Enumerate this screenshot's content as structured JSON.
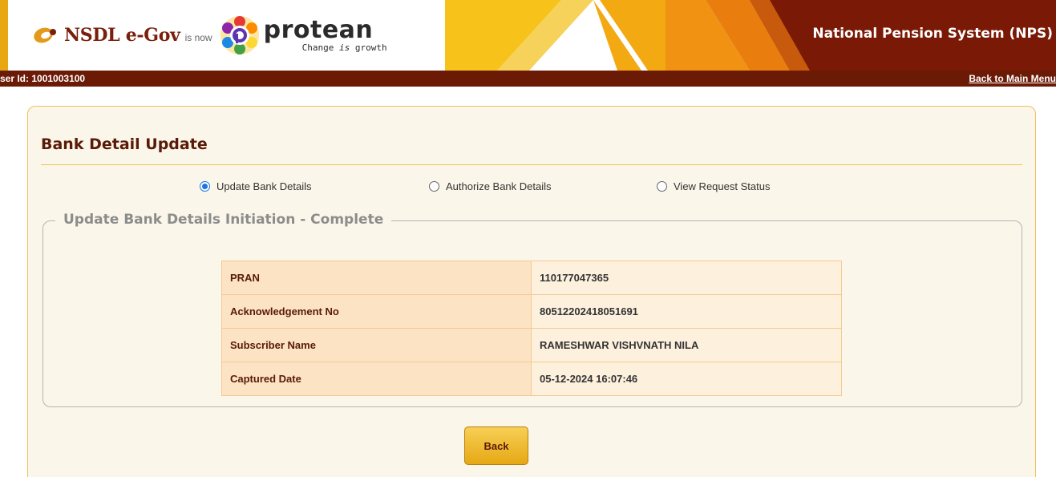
{
  "header": {
    "nsdl_logo": "NSDL e-Gov",
    "is_now": "is now",
    "protean_logo": "protean",
    "protean_tagline_pre": "Change ",
    "protean_tagline_is": "is",
    "protean_tagline_post": " growth",
    "system_title": "National Pension System (NPS)",
    "user_id": "ser Id: 1001003100",
    "back_to_menu": "Back to Main Menu"
  },
  "page": {
    "title": "Bank Detail Update"
  },
  "radio_options": [
    {
      "label": "Update Bank Details",
      "checked": true
    },
    {
      "label": "Authorize Bank Details",
      "checked": false
    },
    {
      "label": "View Request Status",
      "checked": false
    }
  ],
  "section": {
    "legend": "Update Bank Details Initiation - Complete"
  },
  "details": [
    {
      "label": "PRAN",
      "value": "110177047365"
    },
    {
      "label": "Acknowledgement No",
      "value": "80512202418051691"
    },
    {
      "label": "Subscriber Name",
      "value": "RAMESHWAR VISHVNATH NILA"
    },
    {
      "label": "Captured Date",
      "value": "05-12-2024 16:07:46"
    }
  ],
  "actions": {
    "back_label": "Back"
  },
  "colors": {
    "brand_maroon": "#6b1a06",
    "accent_orange": "#f0a21a",
    "radio_blue": "#1a73e8"
  }
}
